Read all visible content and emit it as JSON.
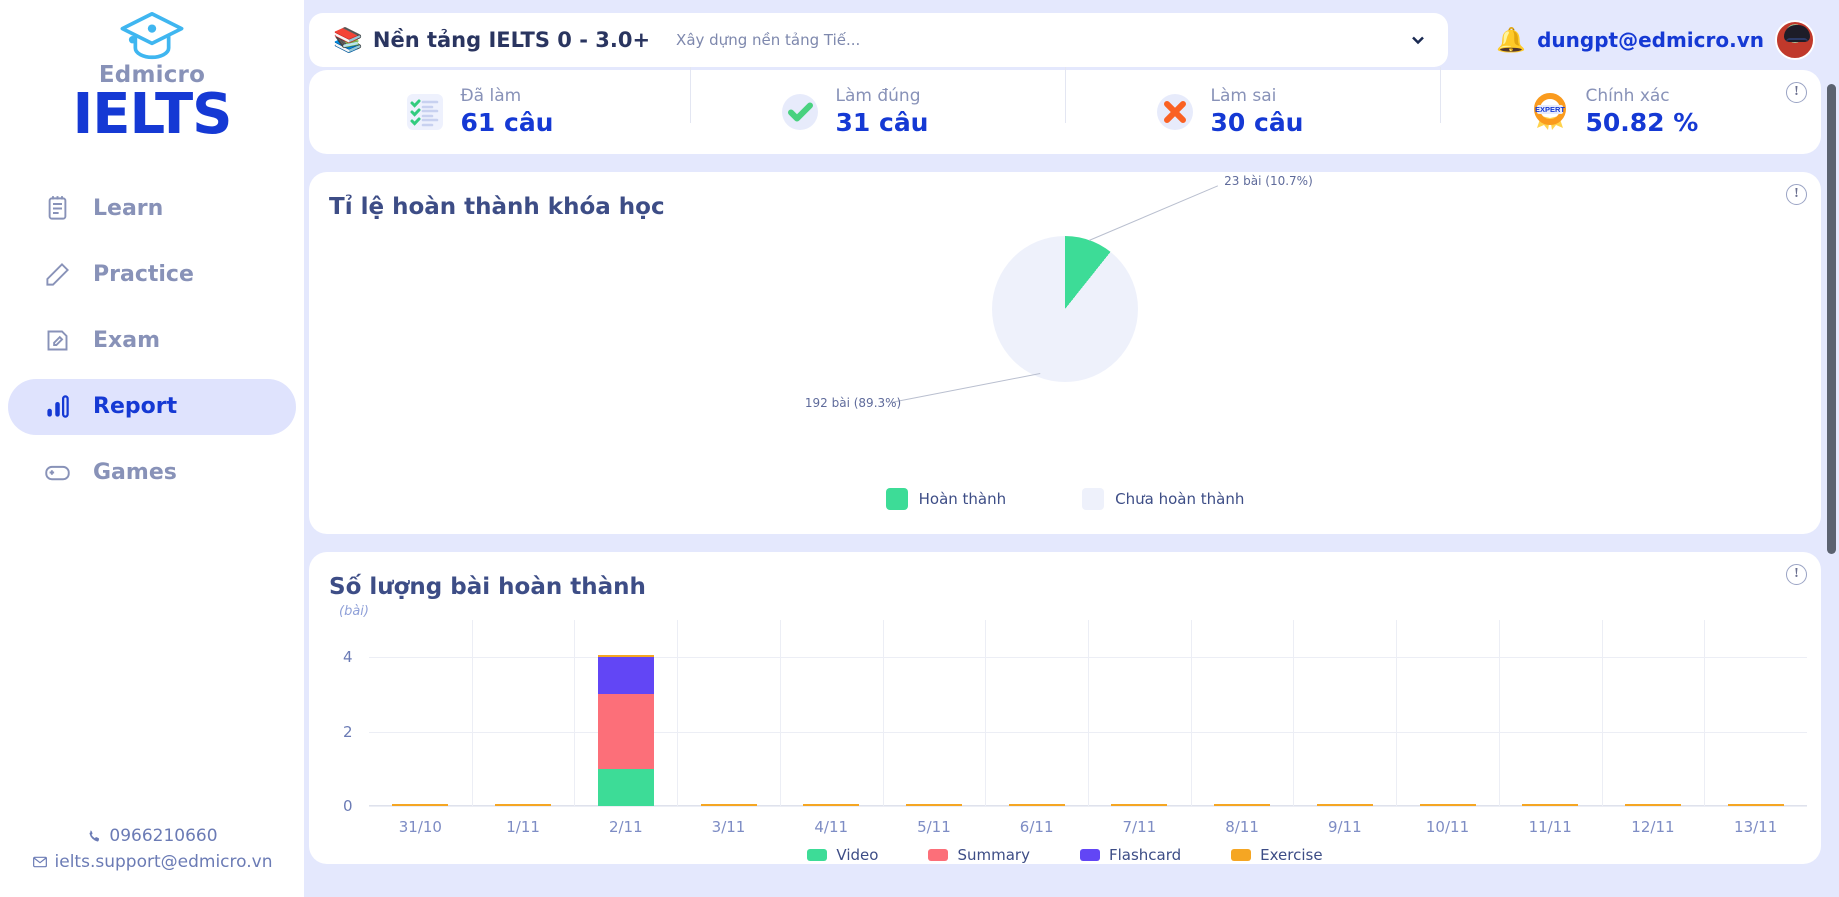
{
  "brand": {
    "sub": "Edmicro",
    "main": "IELTS",
    "logo_icon": "graduation-cap-icon"
  },
  "sidebar": {
    "items": [
      {
        "label": "Learn",
        "icon": "notebook-icon",
        "active": false
      },
      {
        "label": "Practice",
        "icon": "pencil-icon",
        "active": false
      },
      {
        "label": "Exam",
        "icon": "exam-note-icon",
        "active": false
      },
      {
        "label": "Report",
        "icon": "bar-chart-icon",
        "active": true
      },
      {
        "label": "Games",
        "icon": "gamepad-icon",
        "active": false
      }
    ],
    "contact": {
      "phone": "0966210660",
      "email": "ielts.support@edmicro.vn"
    }
  },
  "header": {
    "course_icon": "books-icon",
    "course_title": "Nền tảng IELTS 0 - 3.0+",
    "course_desc": "Xây dựng nền tảng Tiế...",
    "dropdown_icon": "chevron-down-icon",
    "bell_icon": "bell-icon",
    "user_email": "dungpt@edmicro.vn",
    "avatar_icon": "avatar"
  },
  "stats": {
    "info_icon": "info-icon",
    "items": [
      {
        "label": "Đã làm",
        "value": "61 câu",
        "icon": "checklist-icon"
      },
      {
        "label": "Làm đúng",
        "value": "31 câu",
        "icon": "check-circle-icon"
      },
      {
        "label": "Làm sai",
        "value": "30 câu",
        "icon": "cross-circle-icon"
      },
      {
        "label": "Chính xác",
        "value": "50.82 %",
        "icon": "expert-medal-icon"
      }
    ]
  },
  "pie_card": {
    "title": "Tỉ lệ hoàn thành khóa học",
    "info_icon": "info-icon"
  },
  "bar_card": {
    "title": "Số lượng bài hoàn thành",
    "info_icon": "info-icon",
    "y_unit": "(bài)"
  },
  "chart_data": [
    {
      "type": "pie",
      "title": "Tỉ lệ hoàn thành khóa học",
      "labels": [
        "Hoàn thành",
        "Chưa hoàn thành"
      ],
      "values": [
        23,
        192
      ],
      "percents": [
        10.7,
        89.3
      ],
      "colors": [
        "#3ddc97",
        "#eef1fb"
      ],
      "annotations": [
        "23 bài (10.7%)",
        "192 bài (89.3%)"
      ],
      "legend_position": "bottom"
    },
    {
      "type": "bar",
      "stacked": true,
      "title": "Số lượng bài hoàn thành",
      "xlabel": "",
      "ylabel": "(bài)",
      "ylim": [
        0,
        5
      ],
      "yticks": [
        0,
        2,
        4
      ],
      "grid": true,
      "legend_position": "bottom",
      "categories": [
        "31/10",
        "1/11",
        "2/11",
        "3/11",
        "4/11",
        "5/11",
        "6/11",
        "7/11",
        "8/11",
        "9/11",
        "10/11",
        "11/11",
        "12/11",
        "13/11"
      ],
      "series": [
        {
          "name": "Video",
          "color": "#3ddc97",
          "values": [
            0,
            0,
            1,
            0,
            0,
            0,
            0,
            0,
            0,
            0,
            0,
            0,
            0,
            0
          ]
        },
        {
          "name": "Summary",
          "color": "#fc6f79",
          "values": [
            0,
            0,
            2,
            0,
            0,
            0,
            0,
            0,
            0,
            0,
            0,
            0,
            0,
            0
          ]
        },
        {
          "name": "Flashcard",
          "color": "#6246f5",
          "values": [
            0,
            0,
            1,
            0,
            0,
            0,
            0,
            0,
            0,
            0,
            0,
            0,
            0,
            0
          ]
        },
        {
          "name": "Exercise",
          "color": "#f5a623",
          "values": [
            0.05,
            0.05,
            0.05,
            0.05,
            0.05,
            0.05,
            0.05,
            0.05,
            0.05,
            0.05,
            0.05,
            0.05,
            0.05,
            0.05
          ]
        }
      ]
    }
  ],
  "colors": {
    "brand_blue": "#1539d4",
    "page_bg": "#e4e8fd",
    "green": "#3ddc97",
    "red": "#fc6f79",
    "purple": "#6246f5",
    "orange": "#f5a623"
  }
}
